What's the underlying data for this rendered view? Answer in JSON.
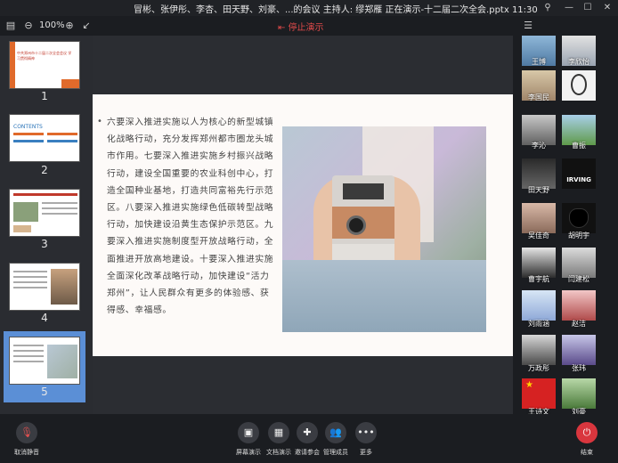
{
  "window": {
    "title": "冒彬、张伊彤、李杏、田天野、刘豪、...的会议 主持人: 缪郑雁 正在演示-十二届二次全会.pptx 11:30"
  },
  "toolbar": {
    "zoom": "100%",
    "stop_label": "停止演示"
  },
  "thumbnails": [
    {
      "num": "1"
    },
    {
      "num": "2"
    },
    {
      "num": "3"
    },
    {
      "num": "4"
    },
    {
      "num": "5"
    }
  ],
  "thumb_texts": {
    "t1": "中共郑州市十二届二次全会会议 学习贯彻精神",
    "t2": "CONTENTS"
  },
  "slide": {
    "text": "六要深入推进实施以人为核心的新型城镇化战略行动，充分发挥郑州都市圈龙头城市作用。七要深入推进实施乡村振兴战略行动，建设全国重要的农业科创中心，打造全国种业基地，打造共同富裕先行示范区。八要深入推进实施绿色低碳转型战略行动，加快建设沿黄生态保护示范区。九要深入推进实施制度型开放战略行动，全面推进开放高地建设。十要深入推进实施全面深化改革战略行动，加快建设“活力郑州”，让人民群众有更多的体验感、获得感、幸福感。"
  },
  "participants": [
    {
      "name": "王博"
    },
    {
      "name": "李欣怡"
    },
    {
      "name": "李国民"
    },
    {
      "name": ""
    },
    {
      "name": "李沁"
    },
    {
      "name": "曹振"
    },
    {
      "name": "田天野"
    },
    {
      "name": ""
    },
    {
      "name": "吴佳奇"
    },
    {
      "name": "胡明宇"
    },
    {
      "name": "曹宇航"
    },
    {
      "name": "闫建松"
    },
    {
      "name": "刘雨涵"
    },
    {
      "name": "赵洁"
    },
    {
      "name": "万政彤"
    },
    {
      "name": "张玮"
    },
    {
      "name": "王诗文"
    },
    {
      "name": "刘豪"
    }
  ],
  "participant_overlay": {
    "irving": "IRVING"
  },
  "bottom": {
    "mute": "取消静音",
    "screen_share": "屏幕演示",
    "doc_share": "文档演示",
    "invite": "邀请参会",
    "members": "管理成员",
    "more": "更多",
    "end": "结束"
  },
  "colors": {
    "accent": "#5b8fd6",
    "stop": "#e04a4a",
    "end": "#d9363e"
  }
}
